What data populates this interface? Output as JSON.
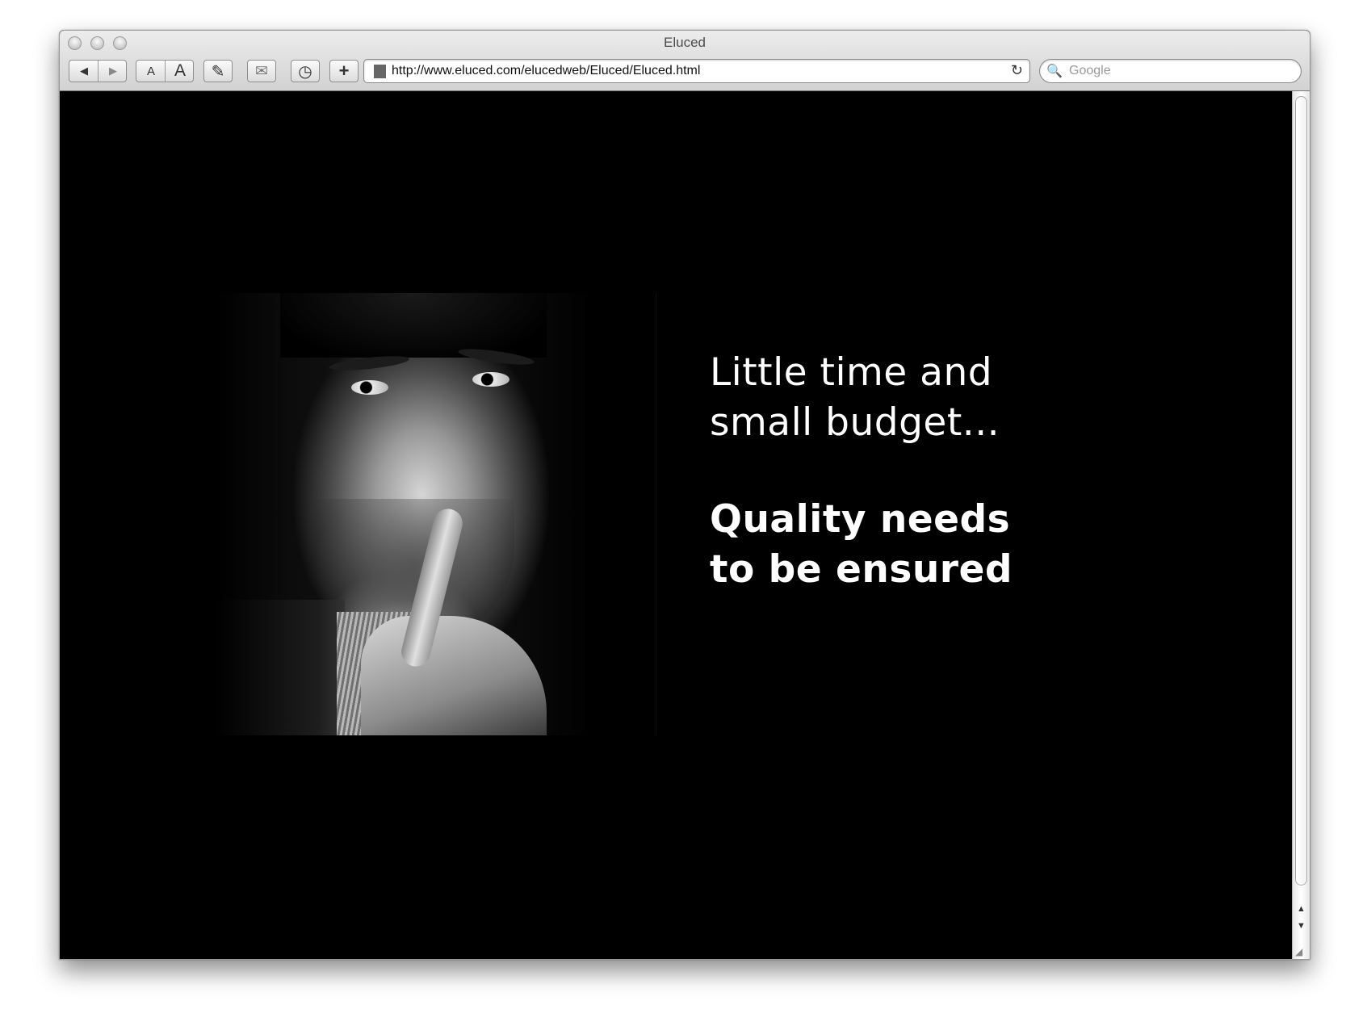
{
  "window": {
    "title": "Eluced"
  },
  "toolbar": {
    "back_icon": "◀",
    "forward_icon": "▶",
    "text_smaller": "A",
    "text_bigger": "A",
    "edit_icon": "✎",
    "mail_icon": "✉",
    "history_icon": "◷",
    "add_icon": "+"
  },
  "address_bar": {
    "url": "http://www.eluced.com/elucedweb/Eluced/Eluced.html",
    "reload_icon": "↻"
  },
  "search": {
    "icon": "🔍",
    "placeholder": "Google"
  },
  "page": {
    "tagline_light": [
      "Little time and",
      "small budget..."
    ],
    "tagline_bold": [
      "Quality needs",
      "to be ensured"
    ]
  },
  "scrollbar": {
    "up_arrow": "▲",
    "down_arrow": "▼"
  },
  "colors": {
    "page_background": "#000000",
    "text": "#ffffff"
  }
}
